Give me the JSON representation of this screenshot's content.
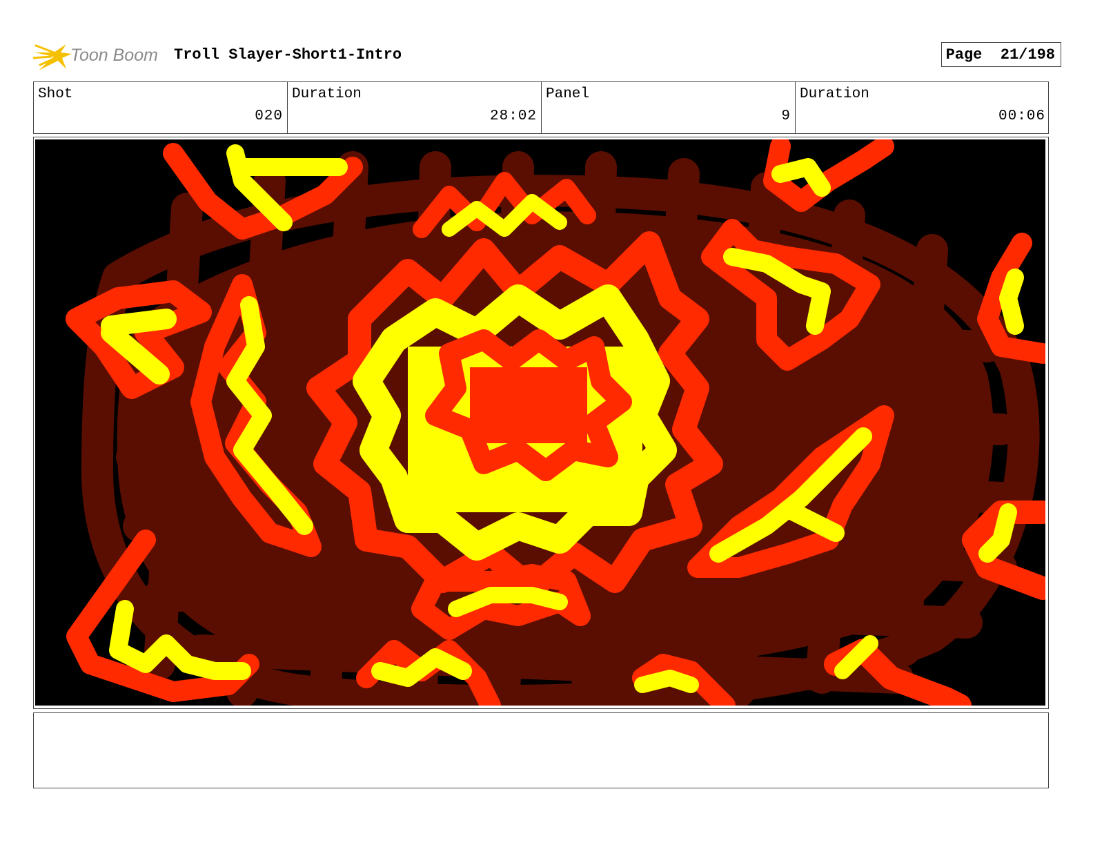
{
  "header": {
    "logo_text": "Toon Boom",
    "title": "Troll Slayer-Short1-Intro",
    "page_label": "Page",
    "page_value": "21/198"
  },
  "info": {
    "shot_label": "Shot",
    "shot_value": "020",
    "shot_duration_label": "Duration",
    "shot_duration_value": "28:02",
    "panel_label": "Panel",
    "panel_value": "9",
    "panel_duration_label": "Duration",
    "panel_duration_value": "00:06"
  },
  "panel": {
    "icon": "explosion-sketch",
    "colors": {
      "background": "#000000",
      "smoke": "#5a0e02",
      "fire_red": "#ff2a00",
      "fire_yellow": "#ffff00"
    }
  },
  "logo": {
    "icon": "comet-logo-icon",
    "colors": {
      "star": "#f5c000",
      "text": "#8a8a8a"
    }
  },
  "notes": ""
}
